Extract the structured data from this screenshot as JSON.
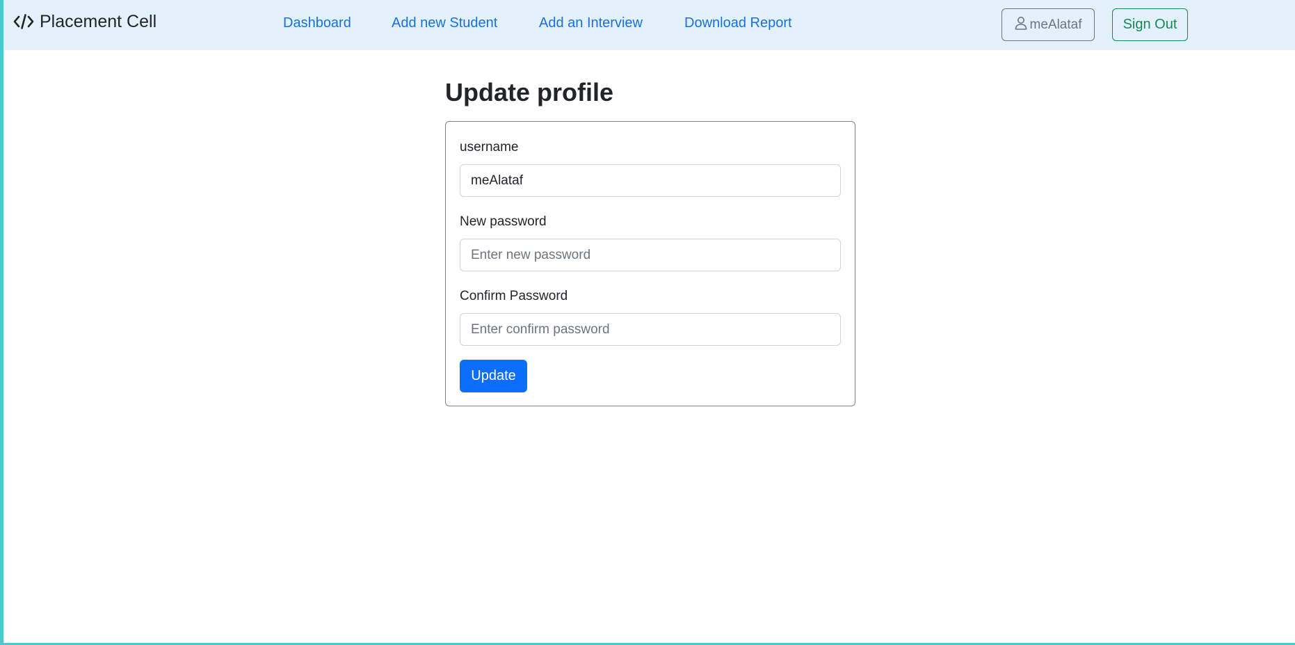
{
  "navbar": {
    "brand": "Placement Cell",
    "brand_icon": "code-icon",
    "links": [
      {
        "label": "Dashboard"
      },
      {
        "label": "Add new Student"
      },
      {
        "label": "Add an Interview"
      },
      {
        "label": "Download Report"
      }
    ],
    "user_icon": "person-icon",
    "user_label": "meAlataf",
    "signout_label": "Sign Out"
  },
  "page": {
    "title": "Update profile"
  },
  "form": {
    "username_label": "username",
    "username_value": "meAlataf",
    "new_password_label": "New password",
    "new_password_placeholder": "Enter new password",
    "confirm_password_label": "Confirm Password",
    "confirm_password_placeholder": "Enter confirm password",
    "submit_label": "Update"
  },
  "colors": {
    "navbar_bg": "#e2f1fb",
    "link": "#1a6fe0",
    "primary": "#0d6efd",
    "success": "#198754",
    "secondary": "#6c757d"
  }
}
